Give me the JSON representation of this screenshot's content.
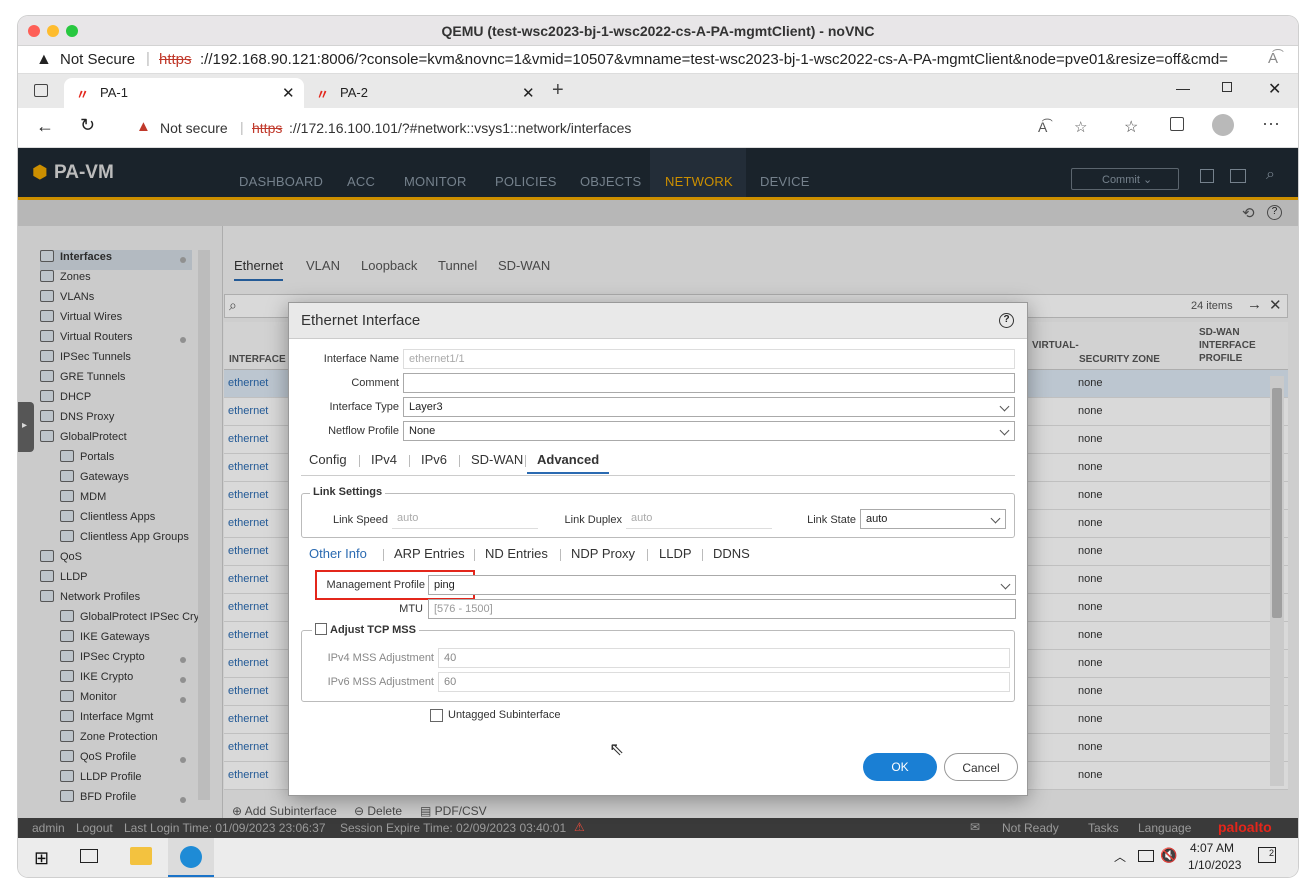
{
  "window": {
    "title": "QEMU (test-wsc2023-bj-1-wsc2022-cs-A-PA-mgmtClient) - noVNC"
  },
  "outer_url": {
    "warning": "Not Secure",
    "scheme": "https",
    "url": "://192.168.90.121:8006/?console=kvm&novnc=1&vmid=10507&vmname=test-wsc2023-bj-1-wsc2022-cs-A-PA-mgmtClient&node=pve01&resize=off&cmd="
  },
  "tabs": [
    {
      "label": "PA-1"
    },
    {
      "label": "PA-2"
    }
  ],
  "address": {
    "warning": "Not secure",
    "scheme": "https",
    "url": "://172.16.100.101/?#network::vsys1::network/interfaces"
  },
  "pan": {
    "logo": "PA-VM",
    "nav": [
      "DASHBOARD",
      "ACC",
      "MONITOR",
      "POLICIES",
      "OBJECTS",
      "NETWORK",
      "DEVICE"
    ],
    "commit": "Commit"
  },
  "sidebar": {
    "items": [
      "Interfaces",
      "Zones",
      "VLANs",
      "Virtual Wires",
      "Virtual Routers",
      "IPSec Tunnels",
      "GRE Tunnels",
      "DHCP",
      "DNS Proxy",
      "GlobalProtect",
      "Portals",
      "Gateways",
      "MDM",
      "Clientless Apps",
      "Clientless App Groups",
      "QoS",
      "LLDP",
      "Network Profiles",
      "GlobalProtect IPSec Cry",
      "IKE Gateways",
      "IPSec Crypto",
      "IKE Crypto",
      "Monitor",
      "Interface Mgmt",
      "Zone Protection",
      "QoS Profile",
      "LLDP Profile",
      "BFD Profile"
    ]
  },
  "content": {
    "tabs": [
      "Ethernet",
      "VLAN",
      "Loopback",
      "Tunnel",
      "SD-WAN"
    ],
    "items_count": "24 items",
    "columns": {
      "interface": "INTERFACE",
      "virtual": "VIRTUAL-",
      "zone": "SECURITY ZONE",
      "sdwan": "SD-WAN INTERFACE PROFILE"
    },
    "row_iface": "ethernet",
    "row_zone": "none",
    "bottom_actions": [
      "Add Subinterface",
      "Delete",
      "PDF/CSV"
    ]
  },
  "dialog": {
    "title": "Ethernet Interface",
    "interface_name_label": "Interface Name",
    "interface_name": "ethernet1/1",
    "comment_label": "Comment",
    "comment": "",
    "interface_type_label": "Interface Type",
    "interface_type": "Layer3",
    "netflow_label": "Netflow Profile",
    "netflow": "None",
    "tabs": [
      "Config",
      "IPv4",
      "IPv6",
      "SD-WAN",
      "Advanced"
    ],
    "link_settings": "Link Settings",
    "link_speed_label": "Link Speed",
    "link_speed": "auto",
    "link_duplex_label": "Link Duplex",
    "link_duplex": "auto",
    "link_state_label": "Link State",
    "link_state": "auto",
    "subtabs": [
      "Other Info",
      "ARP Entries",
      "ND Entries",
      "NDP Proxy",
      "LLDP",
      "DDNS"
    ],
    "mgmt_profile_label": "Management Profile",
    "mgmt_profile": "ping",
    "mtu_label": "MTU",
    "mtu_placeholder": "[576 - 1500]",
    "adjust_tcp": "Adjust TCP MSS",
    "ipv4_mss_label": "IPv4 MSS Adjustment",
    "ipv4_mss": "40",
    "ipv6_mss_label": "IPv6 MSS Adjustment",
    "ipv6_mss": "60",
    "untagged": "Untagged Subinterface",
    "ok": "OK",
    "cancel": "Cancel"
  },
  "footer": {
    "user": "admin",
    "logout": "Logout",
    "last_login": "Last Login Time: 01/09/2023 23:06:37",
    "session": "Session Expire Time: 02/09/2023 03:40:01",
    "status": "Not Ready",
    "tasks": "Tasks",
    "language": "Language",
    "brand": "paloalto"
  },
  "taskbar": {
    "time": "4:07 AM",
    "date": "1/10/2023",
    "notif": "2"
  },
  "colors": {
    "accent": "#f0a800",
    "link": "#2a6ab1",
    "ok": "#1a7fd4",
    "highlight": "#e3261b"
  }
}
